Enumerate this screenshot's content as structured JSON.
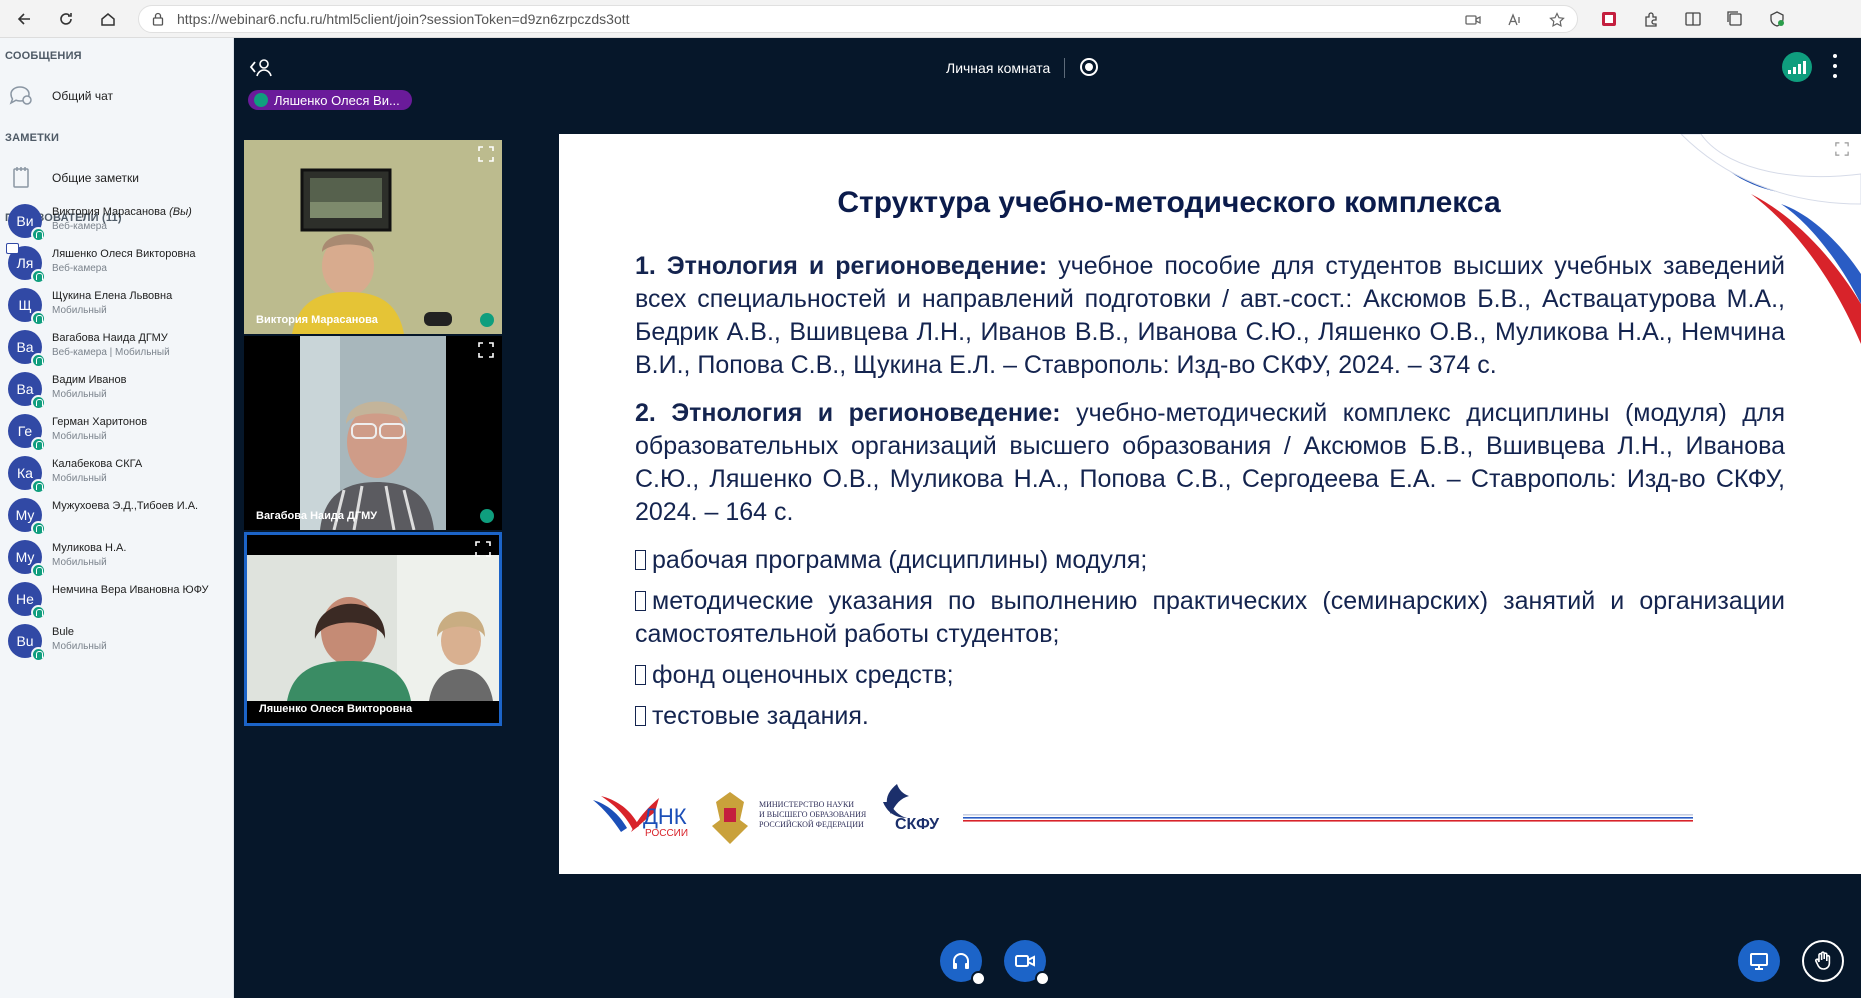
{
  "browser": {
    "url": "https://webinar6.ncfu.ru/html5client/join?sessionToken=d9zn6zrpczds3ott"
  },
  "sidebar": {
    "messages_title": "СООБЩЕНИЯ",
    "public_chat": "Общий чат",
    "notes_title": "ЗАМЕТКИ",
    "shared_notes": "Общие заметки",
    "users_title": "ПОЛЬЗОВАТЕЛИ (11)",
    "users": [
      {
        "initials": "Ви",
        "name": "Виктория Марасанова",
        "you": "(Вы)",
        "status": "Веб-камера",
        "presenter": false
      },
      {
        "initials": "Ля",
        "name": "Ляшенко Олеся Викторовна",
        "you": "",
        "status": "Веб-камера",
        "presenter": true
      },
      {
        "initials": "Щ",
        "name": "Щукина Елена Львовна",
        "you": "",
        "status": "Мобильный",
        "presenter": false
      },
      {
        "initials": "Ва",
        "name": "Вагабова Наида ДГМУ",
        "you": "",
        "status": "Веб-камера | Мобильный",
        "presenter": false
      },
      {
        "initials": "Ва",
        "name": "Вадим Иванов",
        "you": "",
        "status": "Мобильный",
        "presenter": false
      },
      {
        "initials": "Ге",
        "name": "Герман Харитонов",
        "you": "",
        "status": "Мобильный",
        "presenter": false
      },
      {
        "initials": "Ка",
        "name": "Калабекова СКГА",
        "you": "",
        "status": "Мобильный",
        "presenter": false
      },
      {
        "initials": "Му",
        "name": "Мужухоева Э.Д.,Тибоев И.А.",
        "you": "",
        "status": "",
        "presenter": false
      },
      {
        "initials": "Му",
        "name": "Муликова Н.А.",
        "you": "",
        "status": "Мобильный",
        "presenter": false
      },
      {
        "initials": "Не",
        "name": "Немчина Вера Ивановна ЮФУ",
        "you": "",
        "status": "",
        "presenter": false
      },
      {
        "initials": "Bu",
        "name": "Bule",
        "you": "",
        "status": "Мобильный",
        "presenter": false
      }
    ]
  },
  "room": {
    "title": "Личная комната",
    "talker": "Ляшенко Олеся Ви..."
  },
  "videos": [
    {
      "name": "Виктория Марасанова"
    },
    {
      "name": "Вагабова Наида ДГМУ"
    },
    {
      "name": "Ляшенко Олеся Викторовна"
    }
  ],
  "slide": {
    "title": "Структура учебно-методического комплекса",
    "p1_bold": "1. Этнология и регионоведение:",
    "p1_text": " учебное пособие для студентов высших учебных заведений всех специальностей и направлений подготовки / авт.-сост.: Аксюмов Б.В., Аствацатурова М.А., Бедрик А.В., Вшивцева Л.Н., Иванов В.В., Иванова С.Ю., Ляшенко О.В., Муликова Н.А., Немчина В.И., Попова С.В., Щукина Е.Л. – Ставрополь: Изд-во СКФУ, 2024. – 374 с.",
    "p2_bold": "2. Этнология и регионоведение:",
    "p2_text": " учебно-методический комплекс дисциплины (модуля) для образовательных организаций высшего образования / Аксюмов Б.В., Вшивцева Л.Н., Иванова С.Ю., Ляшенко О.В., Муликова Н.А., Попова С.В., Сергодеева Е.А. – Ставрополь: Изд-во СКФУ, 2024. – 164 с.",
    "bullets": [
      "рабочая программа (дисциплины) модуля;",
      "методические указания по выполнению практических (семинарских) занятий и организации самостоятельной работы студентов;",
      "фонд оценочных средств;",
      "тестовые задания."
    ],
    "logo1": "ДНК",
    "logo1_sub": "РОССИИ",
    "ministry_line1": "МИНИСТЕРСТВО НАУКИ",
    "ministry_line2": "И ВЫСШЕГО ОБРАЗОВАНИЯ",
    "ministry_line3": "РОССИЙСКОЙ ФЕДЕРАЦИИ",
    "logo3": "СКФУ"
  },
  "colors": {
    "accent": "#1c64c8",
    "success": "#0f9e7e",
    "talker": "#6a1b9a",
    "background": "#06172a"
  }
}
